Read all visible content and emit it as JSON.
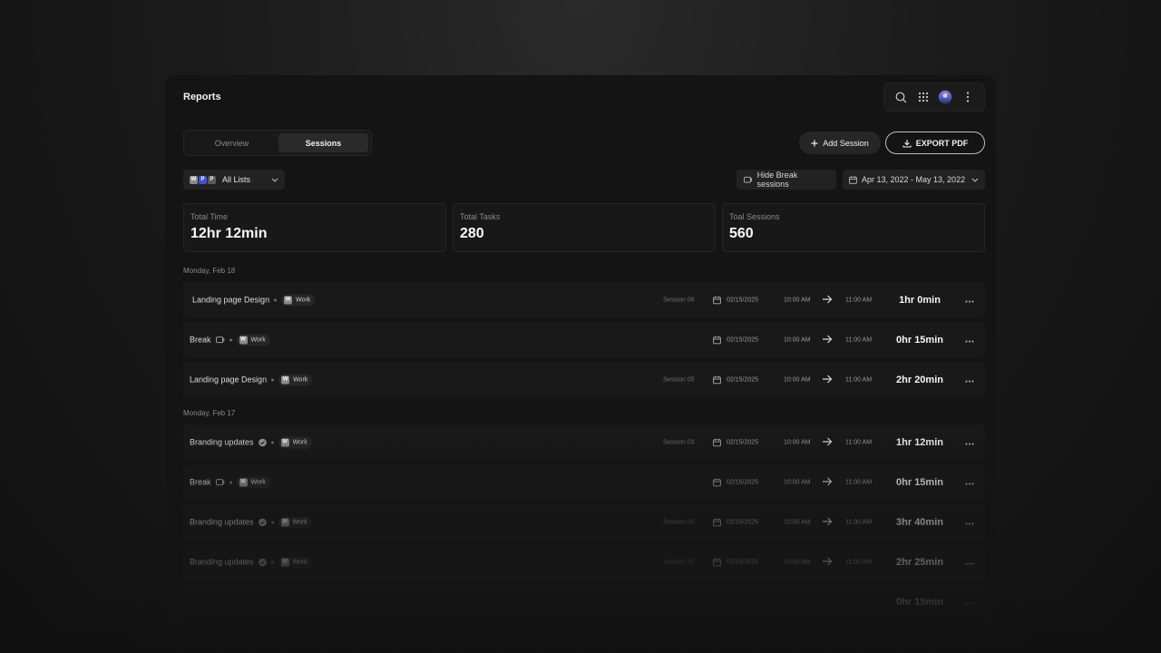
{
  "header": {
    "title": "Reports"
  },
  "tabs": [
    {
      "label": "Overview",
      "active": false
    },
    {
      "label": "Sessions",
      "active": true
    }
  ],
  "actions": {
    "add_session": "Add Session",
    "export_pdf": "EXPORT PDF"
  },
  "filters": {
    "lists_label": "All Lists",
    "list_badges": [
      {
        "letter": "W",
        "color": "#8b8b8b"
      },
      {
        "letter": "P",
        "color": "#3f51d6"
      },
      {
        "letter": "P",
        "color": "#5b5b5b"
      }
    ],
    "hide_break": "Hide Break sessions",
    "date_range": "Apr 13, 2022 - May 13, 2022"
  },
  "stats": [
    {
      "label": "Total Time",
      "value": "12hr 12min"
    },
    {
      "label": "Total Tasks",
      "value": "280"
    },
    {
      "label": "Toal Sessions",
      "value": "560"
    }
  ],
  "groups": [
    {
      "day": "Monday, Feb 18",
      "rows": [
        {
          "name": "Landing page Design",
          "icon": "",
          "tag": "Work",
          "session": "Session 06",
          "date": "02/15/2025",
          "start": "10:00 AM",
          "end": "11:00 AM",
          "duration": "1hr 0min"
        },
        {
          "name": "Break",
          "icon": "break-icon",
          "tag": "Work",
          "session": "",
          "date": "02/15/2025",
          "start": "10:00 AM",
          "end": "11:00 AM",
          "duration": "0hr 15min"
        },
        {
          "name": "Landing page Design",
          "icon": "",
          "tag": "Work",
          "session": "Session 05",
          "date": "02/15/2025",
          "start": "10:00 AM",
          "end": "11:00 AM",
          "duration": "2hr 20min"
        }
      ]
    },
    {
      "day": "Monday, Feb 17",
      "rows": [
        {
          "name": "Branding updates",
          "icon": "check-icon",
          "tag": "Work",
          "session": "Session 03",
          "date": "02/15/2025",
          "start": "10:00 AM",
          "end": "11:00 AM",
          "duration": "1hr 12min"
        },
        {
          "name": "Break",
          "icon": "break-icon",
          "tag": "Work",
          "session": "",
          "date": "02/15/2025",
          "start": "10:00 AM",
          "end": "11:00 AM",
          "duration": "0hr 15min"
        },
        {
          "name": "Branding updates",
          "icon": "check-icon",
          "tag": "Work",
          "session": "Session 02",
          "date": "02/15/2025",
          "start": "10:00 AM",
          "end": "11:00 AM",
          "duration": "3hr 40min"
        },
        {
          "name": "Branding updates",
          "icon": "check-icon",
          "tag": "Work",
          "session": "Session 01",
          "date": "02/15/2025",
          "start": "10:00 AM",
          "end": "11:00 AM",
          "duration": "2hr 25min"
        },
        {
          "name": "",
          "icon": "",
          "tag": "",
          "session": "",
          "date": "",
          "start": "",
          "end": "",
          "duration": "0hr 15min"
        }
      ]
    }
  ]
}
